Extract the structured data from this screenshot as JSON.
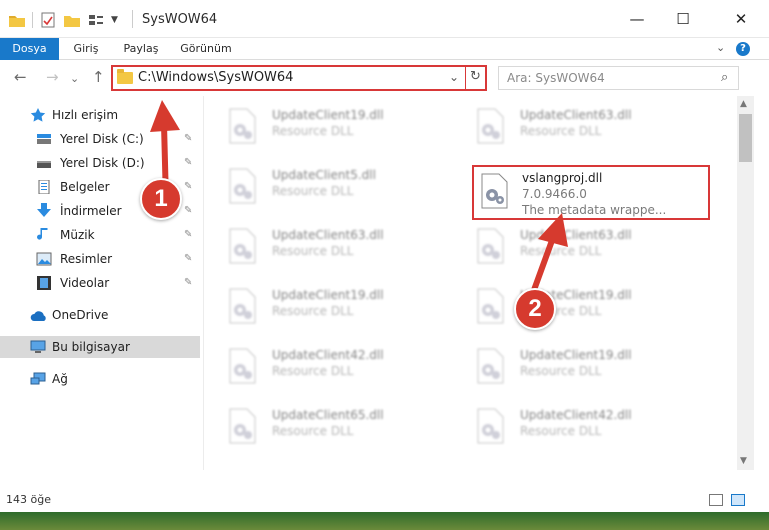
{
  "window": {
    "title": "SysWOW64",
    "minimize": "—",
    "maximize": "☐",
    "close": "✕"
  },
  "ribbon": {
    "tabs": [
      "Dosya",
      "Giriş",
      "Paylaş",
      "Görünüm"
    ],
    "collapse": "⌄",
    "help": "?"
  },
  "nav": {
    "back": "←",
    "forward": "→",
    "history": "⌄",
    "up": "↑",
    "address": "C:\\Windows\\SysWOW64",
    "address_dropdown": "⌄",
    "refresh": "↻",
    "search_placeholder": "Ara: SysWOW64",
    "search_icon": "⌕"
  },
  "sidebar": {
    "items": [
      {
        "label": "Hızlı erişim",
        "icon": "star-icon"
      },
      {
        "label": "Yerel Disk (C:)",
        "icon": "disk-icon",
        "pin": "📌"
      },
      {
        "label": "Yerel Disk (D:)",
        "icon": "disk-icon",
        "pin": "📌"
      },
      {
        "label": "Belgeler",
        "icon": "documents-icon",
        "pin": "📌"
      },
      {
        "label": "İndirmeler",
        "icon": "download-icon",
        "pin": "📌"
      },
      {
        "label": "Müzik",
        "icon": "music-icon",
        "pin": "📌"
      },
      {
        "label": "Resimler",
        "icon": "pictures-icon",
        "pin": "📌"
      },
      {
        "label": "Videolar",
        "icon": "videos-icon",
        "pin": "📌"
      },
      {
        "label": "OneDrive",
        "icon": "cloud-icon"
      },
      {
        "label": "Bu bilgisayar",
        "icon": "computer-icon"
      },
      {
        "label": "Ağ",
        "icon": "network-icon"
      }
    ]
  },
  "files": {
    "left_column": [
      {
        "name": "UpdateClient19.dll",
        "desc": "Resource DLL"
      },
      {
        "name": "UpdateClient5.dll",
        "desc": "Resource DLL"
      },
      {
        "name": "UpdateClient63.dll",
        "desc": "Resource DLL"
      },
      {
        "name": "UpdateClient19.dll",
        "desc": "Resource DLL"
      },
      {
        "name": "UpdateClient42.dll",
        "desc": "Resource DLL"
      },
      {
        "name": "UpdateClient65.dll",
        "desc": "Resource DLL"
      }
    ],
    "right_column": [
      {
        "name": "UpdateClient63.dll",
        "desc": "Resource DLL"
      },
      {
        "name": "UpdateClient63.dll",
        "desc": "Resource DLL"
      },
      {
        "name": "UpdateClient19.dll",
        "desc": "Resource DLL"
      },
      {
        "name": "UpdateClient19.dll",
        "desc": "Resource DLL"
      },
      {
        "name": "UpdateClient42.dll",
        "desc": "Resource DLL"
      }
    ],
    "highlighted": {
      "name": "vslangproj.dll",
      "version": "7.0.9466.0",
      "desc": "The metadata wrappe..."
    }
  },
  "status": {
    "count": "143 öğe"
  },
  "callouts": {
    "one": "1",
    "two": "2"
  },
  "colors": {
    "accent": "#1979ca",
    "highlight": "#d83838",
    "badge": "#d63a2e"
  }
}
